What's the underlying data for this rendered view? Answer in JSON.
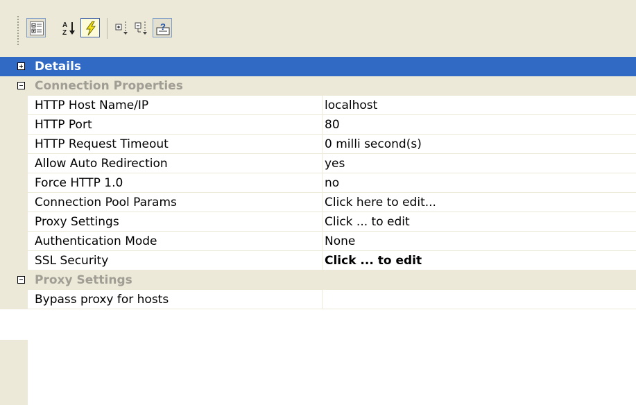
{
  "toolbar": {
    "buttons": [
      {
        "icon": "categorized-icon",
        "state": "pressed"
      },
      {
        "icon": "sort-alphabetical-icon",
        "state": "normal"
      },
      {
        "icon": "events-lightning-icon",
        "state": "active"
      },
      {
        "icon": "expand-all-icon",
        "state": "normal"
      },
      {
        "icon": "collapse-all-icon",
        "state": "normal"
      },
      {
        "icon": "help-description-icon",
        "state": "pressed"
      }
    ]
  },
  "categories": {
    "details": {
      "label": "Details",
      "expanded": false,
      "selected": true
    },
    "connection": {
      "label": "Connection Properties",
      "expanded": true
    },
    "proxy": {
      "label": "Proxy Settings",
      "expanded": true
    }
  },
  "connection_props": [
    {
      "name": "HTTP Host Name/IP",
      "value": "localhost"
    },
    {
      "name": "HTTP Port",
      "value": "80"
    },
    {
      "name": "HTTP Request Timeout",
      "value": "0 milli second(s)"
    },
    {
      "name": "Allow Auto Redirection",
      "value": "yes"
    },
    {
      "name": "Force HTTP 1.0",
      "value": "no"
    },
    {
      "name": "Connection Pool Params",
      "value": "Click here to edit..."
    },
    {
      "name": "Proxy Settings",
      "value": "Click ... to edit"
    },
    {
      "name": "Authentication Mode",
      "value": "None"
    },
    {
      "name": "SSL Security",
      "value": "Click ... to edit"
    }
  ],
  "proxy_props": [
    {
      "name": "Bypass proxy for hosts",
      "value": ""
    }
  ],
  "colors": {
    "selection": "#316ac5",
    "category_bg": "#ece9d8",
    "category_text": "#a09e94",
    "active_button": "#fefbd9"
  }
}
